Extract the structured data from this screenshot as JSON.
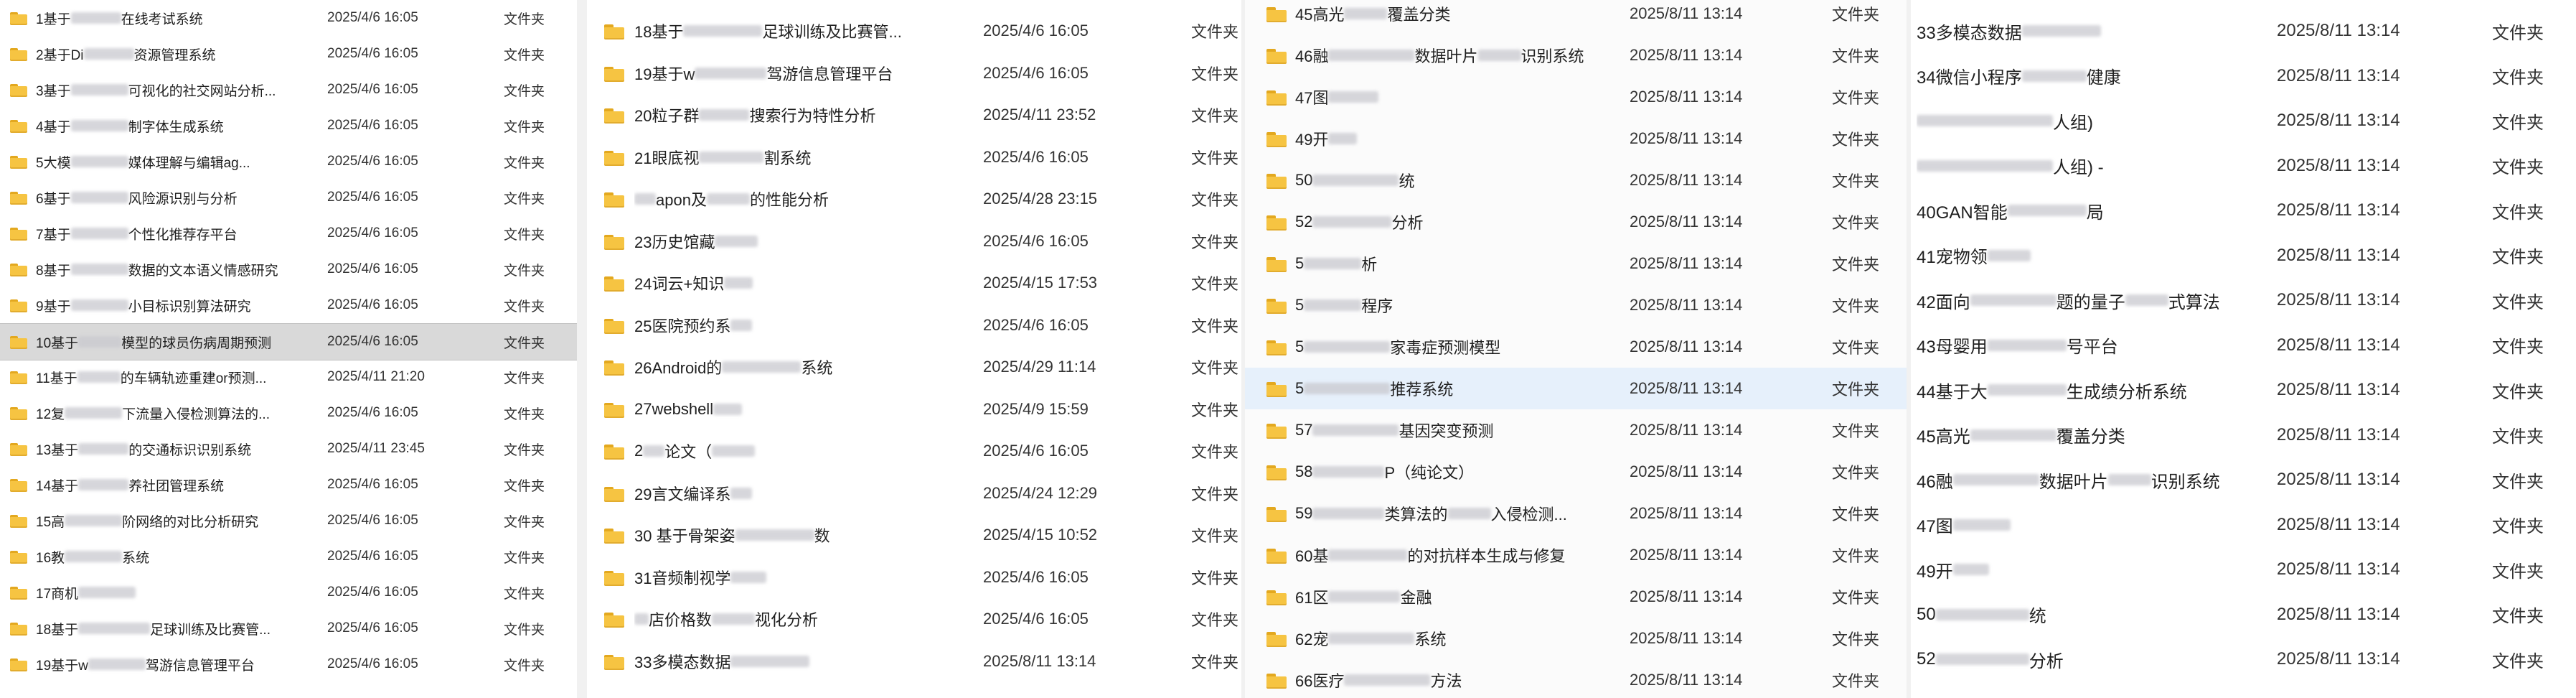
{
  "panels": [
    {
      "id": "p1",
      "rows": [
        {
          "name": "1基于",
          "blur": 70,
          "tail": "在线考试系统",
          "date": "2025/4/6 16:05",
          "type": "文件夹"
        },
        {
          "name": "2基于Di",
          "blur": 70,
          "tail": "资源管理系统",
          "date": "2025/4/6 16:05",
          "type": "文件夹"
        },
        {
          "name": "3基于",
          "blur": 80,
          "tail": "可视化的社交网站分析...",
          "date": "2025/4/6 16:05",
          "type": "文件夹"
        },
        {
          "name": "4基于",
          "blur": 80,
          "tail": "制字体生成系统",
          "date": "2025/4/6 16:05",
          "type": "文件夹"
        },
        {
          "name": "5大模",
          "blur": 80,
          "tail": "媒体理解与编辑ag...",
          "date": "2025/4/6 16:05",
          "type": "文件夹"
        },
        {
          "name": "6基于",
          "blur": 80,
          "tail": "风险源识别与分析",
          "date": "2025/4/6 16:05",
          "type": "文件夹"
        },
        {
          "name": "7基于",
          "blur": 80,
          "tail": "个性化推荐存平台",
          "date": "2025/4/6 16:05",
          "type": "文件夹"
        },
        {
          "name": "8基于",
          "blur": 80,
          "tail": "数据的文本语义情感研究",
          "date": "2025/4/6 16:05",
          "type": "文件夹"
        },
        {
          "name": "9基于",
          "blur": 80,
          "tail": "小目标识别算法研究",
          "date": "2025/4/6 16:05",
          "type": "文件夹"
        },
        {
          "name": "10基于",
          "blur": 60,
          "tail": "模型的球员伤病周期预测",
          "date": "2025/4/6 16:05",
          "type": "文件夹",
          "state": "selected"
        },
        {
          "name": "11基于",
          "blur": 60,
          "tail": "的车辆轨迹重建or预测...",
          "date": "2025/4/11 21:20",
          "type": "文件夹"
        },
        {
          "name": "12复",
          "blur": 80,
          "tail": "下流量入侵检测算法的...",
          "date": "2025/4/6 16:05",
          "type": "文件夹"
        },
        {
          "name": "13基于",
          "blur": 70,
          "tail": "的交通标识识别系统",
          "date": "2025/4/11 23:45",
          "type": "文件夹"
        },
        {
          "name": "14基于",
          "blur": 70,
          "tail": "养社团管理系统",
          "date": "2025/4/6 16:05",
          "type": "文件夹"
        },
        {
          "name": "15高",
          "blur": 80,
          "tail": "阶网络的对比分析研究",
          "date": "2025/4/6 16:05",
          "type": "文件夹"
        },
        {
          "name": "16教",
          "blur": 80,
          "tail": "系统",
          "date": "2025/4/6 16:05",
          "type": "文件夹"
        },
        {
          "name": "17商机",
          "blur": 80,
          "tail": "",
          "date": "2025/4/6 16:05",
          "type": "文件夹"
        },
        {
          "name": "18基于",
          "blur": 100,
          "tail": "足球训练及比赛管...",
          "date": "2025/4/6 16:05",
          "type": "文件夹"
        },
        {
          "name": "19基于w",
          "blur": 80,
          "tail": "驾游信息管理平台",
          "date": "2025/4/6 16:05",
          "type": "文件夹"
        }
      ]
    },
    {
      "id": "p2",
      "rows": [
        {
          "name": "18基于",
          "blur": 110,
          "tail": "足球训练及比赛管...",
          "date": "2025/4/6 16:05",
          "type": "文件夹"
        },
        {
          "name": "19基于w",
          "blur": 100,
          "tail": "驾游信息管理平台",
          "date": "2025/4/6 16:05",
          "type": "文件夹"
        },
        {
          "name": "20粒子群",
          "blur": 70,
          "tail": "搜索行为特性分析",
          "date": "2025/4/11 23:52",
          "type": "文件夹"
        },
        {
          "name": "21眼底视",
          "blur": 90,
          "tail": "割系统",
          "date": "2025/4/6 16:05",
          "type": "文件夹"
        },
        {
          "name": "",
          "blur": 30,
          "tail": "apon及",
          "tail2": "的性能分析",
          "date": "2025/4/28 23:15",
          "type": "文件夹"
        },
        {
          "name": "23历史馆藏",
          "blur": 60,
          "tail": "",
          "date": "2025/4/6 16:05",
          "type": "文件夹"
        },
        {
          "name": "24词云+知识",
          "blur": 40,
          "tail": "",
          "date": "2025/4/15 17:53",
          "type": "文件夹"
        },
        {
          "name": "25医院预约系",
          "blur": 30,
          "tail": "",
          "date": "2025/4/6 16:05",
          "type": "文件夹"
        },
        {
          "name": "26Android的",
          "blur": 110,
          "tail": "系统",
          "date": "2025/4/29 11:14",
          "type": "文件夹"
        },
        {
          "name": "27webshell",
          "blur": 40,
          "tail": "",
          "date": "2025/4/9 15:59",
          "type": "文件夹"
        },
        {
          "name": "2",
          "blur": 30,
          "tail": "论文（",
          "tail2": "",
          "date": "2025/4/6 16:05",
          "type": "文件夹"
        },
        {
          "name": "29言文编译系",
          "blur": 30,
          "tail": "",
          "date": "2025/4/24 12:29",
          "type": "文件夹"
        },
        {
          "name": "30 基于骨架姿",
          "blur": 110,
          "tail": "数",
          "date": "2025/4/15 10:52",
          "type": "文件夹"
        },
        {
          "name": "31音频制视学",
          "blur": 50,
          "tail": "",
          "date": "2025/4/6 16:05",
          "type": "文件夹"
        },
        {
          "name": "",
          "blur": 20,
          "tail": "店价格数",
          "tail2": "视化分析",
          "date": "2025/4/6 16:05",
          "type": "文件夹"
        },
        {
          "name": "33多模态数据",
          "blur": 110,
          "tail": "",
          "date": "2025/8/11 13:14",
          "type": "文件夹"
        }
      ]
    },
    {
      "id": "p3",
      "rows": [
        {
          "name": "45高光",
          "blur": 60,
          "tail": "覆盖分类",
          "date": "2025/8/11 13:14",
          "type": "文件夹"
        },
        {
          "name": "46融",
          "blur": 120,
          "tail": "数据叶片",
          "tail2": "识别系统",
          "date": "2025/8/11 13:14",
          "type": "文件夹"
        },
        {
          "name": "47图",
          "blur": 70,
          "tail": "",
          "date": "2025/8/11 13:14",
          "type": "文件夹"
        },
        {
          "name": "49开",
          "blur": 40,
          "tail": "",
          "date": "2025/8/11 13:14",
          "type": "文件夹"
        },
        {
          "name": "50",
          "blur": 120,
          "tail": "统",
          "date": "2025/8/11 13:14",
          "type": "文件夹"
        },
        {
          "name": "52",
          "blur": 110,
          "tail": "分析",
          "date": "2025/8/11 13:14",
          "type": "文件夹"
        },
        {
          "name": "5",
          "blur": 80,
          "tail": "析",
          "date": "2025/8/11 13:14",
          "type": "文件夹"
        },
        {
          "name": "5",
          "blur": 80,
          "tail": "程序",
          "date": "2025/8/11 13:14",
          "type": "文件夹"
        },
        {
          "name": "5",
          "blur": 120,
          "tail": "家毒症预测模型",
          "date": "2025/8/11 13:14",
          "type": "文件夹"
        },
        {
          "name": "5",
          "blur": 120,
          "tail": "推荐系统",
          "date": "2025/8/11 13:14",
          "type": "文件夹",
          "state": "hover"
        },
        {
          "name": "57",
          "blur": 120,
          "tail": "基因突变预测",
          "date": "2025/8/11 13:14",
          "type": "文件夹"
        },
        {
          "name": "58",
          "blur": 100,
          "tail": "P（纯论文）",
          "date": "2025/8/11 13:14",
          "type": "文件夹"
        },
        {
          "name": "59",
          "blur": 100,
          "tail": "类算法的",
          "tail2": "入侵检测...",
          "date": "2025/8/11 13:14",
          "type": "文件夹"
        },
        {
          "name": "60基",
          "blur": 110,
          "tail": "的对抗样本生成与修复",
          "date": "2025/8/11 13:14",
          "type": "文件夹"
        },
        {
          "name": "61区",
          "blur": 100,
          "tail": "金融",
          "date": "2025/8/11 13:14",
          "type": "文件夹"
        },
        {
          "name": "62宠",
          "blur": 120,
          "tail": "系统",
          "date": "2025/8/11 13:14",
          "type": "文件夹"
        },
        {
          "name": "66医疗",
          "blur": 120,
          "tail": "方法",
          "date": "2025/8/11 13:14",
          "type": "文件夹"
        }
      ]
    },
    {
      "id": "p4",
      "rows": [
        {
          "name": "33多模态数据",
          "blur": 110,
          "tail": "",
          "date": "2025/8/11 13:14",
          "type": "文件夹"
        },
        {
          "name": "34微信小程序",
          "blur": 90,
          "tail": "健康",
          "date": "2025/8/11 13:14",
          "type": "文件夹"
        },
        {
          "name": "",
          "blur": 190,
          "tail": "人组)",
          "date": "2025/8/11 13:14",
          "type": "文件夹"
        },
        {
          "name": "",
          "blur": 190,
          "tail": "人组)  -",
          "date": "2025/8/11 13:14",
          "type": "文件夹"
        },
        {
          "name": "40GAN智能",
          "blur": 110,
          "tail": "局",
          "date": "2025/8/11 13:14",
          "type": "文件夹"
        },
        {
          "name": "41宠物领",
          "blur": 60,
          "tail": "",
          "date": "2025/8/11 13:14",
          "type": "文件夹"
        },
        {
          "name": "42面向",
          "blur": 120,
          "tail": "题的量子",
          "tail2": "式算法",
          "date": "2025/8/11 13:14",
          "type": "文件夹"
        },
        {
          "name": "43母婴用",
          "blur": 110,
          "tail": "号平台",
          "date": "2025/8/11 13:14",
          "type": "文件夹"
        },
        {
          "name": "44基于大",
          "blur": 110,
          "tail": "生成绩分析系统",
          "date": "2025/8/11 13:14",
          "type": "文件夹"
        },
        {
          "name": "45高光",
          "blur": 120,
          "tail": "覆盖分类",
          "date": "2025/8/11 13:14",
          "type": "文件夹"
        },
        {
          "name": "46融",
          "blur": 120,
          "tail": "数据叶片",
          "tail2": "识别系统",
          "date": "2025/8/11 13:14",
          "type": "文件夹"
        },
        {
          "name": "47图",
          "blur": 80,
          "tail": "",
          "date": "2025/8/11 13:14",
          "type": "文件夹"
        },
        {
          "name": "49开",
          "blur": 50,
          "tail": "",
          "date": "2025/8/11 13:14",
          "type": "文件夹"
        },
        {
          "name": "50",
          "blur": 130,
          "tail": "统",
          "date": "2025/8/11 13:14",
          "type": "文件夹"
        },
        {
          "name": "52",
          "blur": 130,
          "tail": "分析",
          "date": "2025/8/11 13:14",
          "type": "文件夹"
        }
      ]
    }
  ]
}
